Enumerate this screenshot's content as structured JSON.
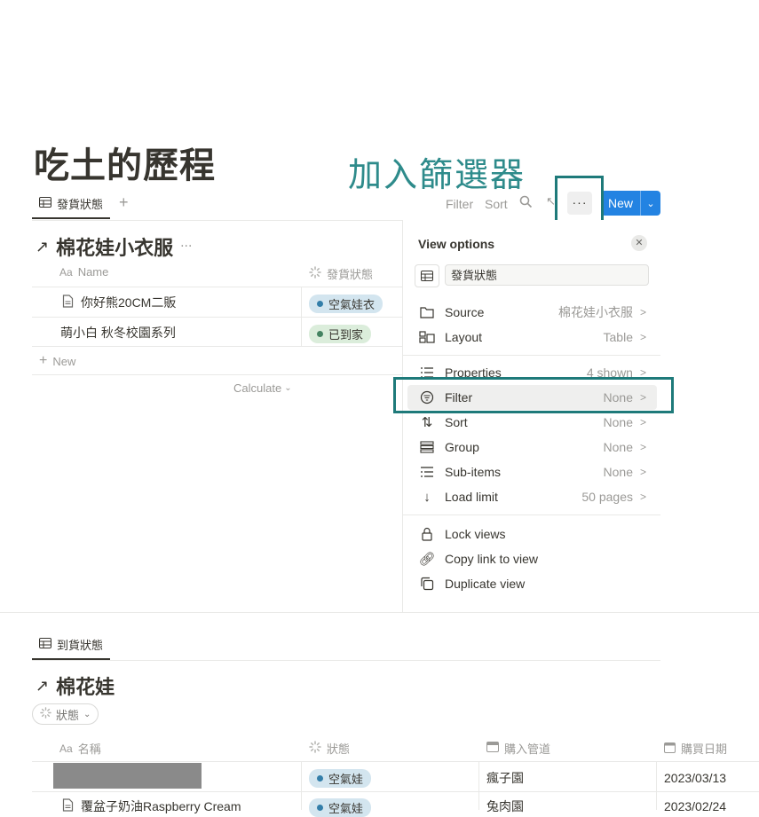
{
  "page": {
    "title": "吃土的歷程"
  },
  "annotation": {
    "text": "加入篩選器"
  },
  "view1": {
    "tab_label": "發貨狀態",
    "toolbar": {
      "filter": "Filter",
      "sort": "Sort",
      "more": "···",
      "new": "New"
    },
    "db_title": "棉花娃小衣服",
    "db_more": "···",
    "columns": {
      "name": "Name",
      "status": "發貨狀態"
    },
    "rows": [
      {
        "name": "你好熊20CM二販",
        "status": "空氣娃衣"
      },
      {
        "name": "萌小白 秋冬校園系列",
        "status": "已到家"
      }
    ],
    "new_row": "New",
    "calculate": "Calculate"
  },
  "view_options": {
    "title": "View options",
    "view_name": "發貨狀態",
    "items": [
      {
        "label": "Source",
        "value": "棉花娃小衣服",
        "icon": "folder-icon"
      },
      {
        "label": "Layout",
        "value": "Table",
        "icon": "layout-icon"
      },
      {
        "label": "Properties",
        "value": "4 shown",
        "icon": "list-icon"
      },
      {
        "label": "Filter",
        "value": "None",
        "icon": "filter-icon"
      },
      {
        "label": "Sort",
        "value": "None",
        "icon": "sort-icon"
      },
      {
        "label": "Group",
        "value": "None",
        "icon": "group-icon"
      },
      {
        "label": "Sub-items",
        "value": "None",
        "icon": "subitems-icon"
      },
      {
        "label": "Load limit",
        "value": "50 pages",
        "icon": "arrow-down-icon"
      }
    ],
    "actions": [
      {
        "label": "Lock views",
        "icon": "lock-icon"
      },
      {
        "label": "Copy link to view",
        "icon": "link-icon"
      },
      {
        "label": "Duplicate view",
        "icon": "duplicate-icon"
      }
    ]
  },
  "view2": {
    "tab_label": "到貨狀態",
    "db_title": "棉花娃",
    "filter_chip": "狀態",
    "columns": {
      "name": "名稱",
      "status": "狀態",
      "channel": "購入管道",
      "date": "購買日期"
    },
    "rows": [
      {
        "name": "",
        "status": "空氣娃",
        "channel": "瘋子園",
        "date": "2023/03/13"
      },
      {
        "name": "覆盆子奶油Raspberry Cream",
        "status": "空氣娃",
        "channel": "兔肉園",
        "date": "2023/02/24"
      }
    ]
  },
  "colors": {
    "accent": "#2383e2",
    "annotation": "#1e7a7a",
    "tag_blue": "#d3e5ef",
    "tag_green": "#dbeddb"
  }
}
